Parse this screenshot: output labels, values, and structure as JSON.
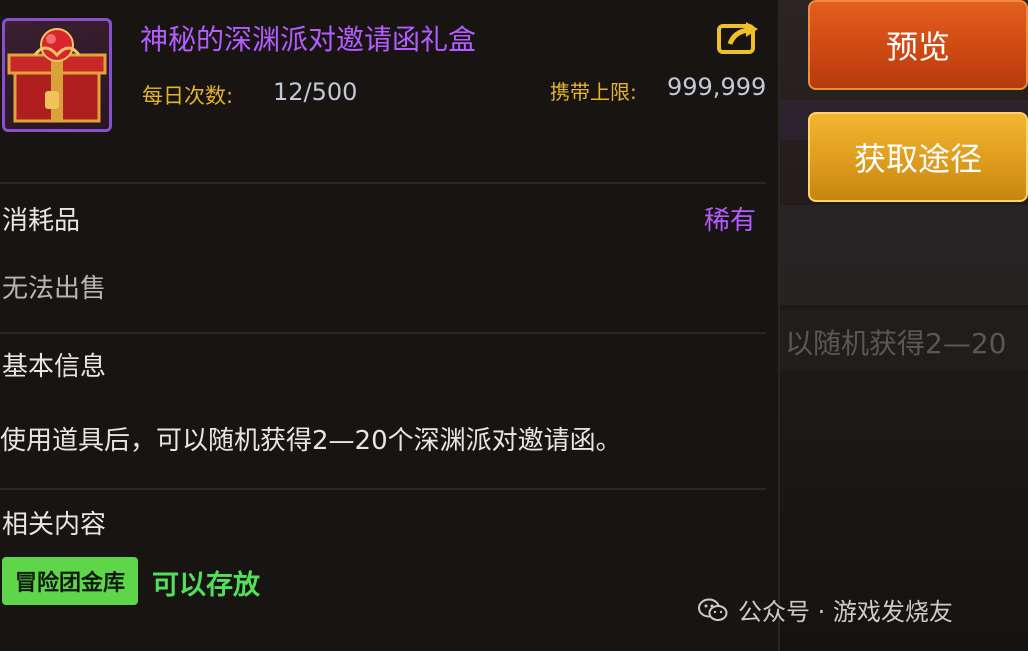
{
  "item": {
    "name": "神秘的深渊派对邀请函礼盒",
    "daily_label": "每日次数:",
    "daily_value": "12/500",
    "carry_label": "携带上限:",
    "carry_value": "999,999",
    "icon": "gift-box-icon"
  },
  "properties": {
    "type": "消耗品",
    "rarity": "稀有",
    "sell": "无法出售"
  },
  "basic_info": {
    "title": "基本信息",
    "description": "使用道具后，可以随机获得2—20个深渊派对邀请函。"
  },
  "related": {
    "title": "相关内容",
    "tag": "冒险团金库",
    "status": "可以存放"
  },
  "buttons": {
    "preview": "预览",
    "source": "获取途径"
  },
  "background": {
    "text_line": "以随机获得2—20"
  },
  "watermark": {
    "text": "公众号 · 游戏发烧友"
  },
  "colors": {
    "rare_purple": "#b45cff",
    "gold_label": "#e4b42a",
    "green_tag": "#5fd64a",
    "preview_orange": "#cc4712",
    "source_gold": "#dc9a1c"
  }
}
